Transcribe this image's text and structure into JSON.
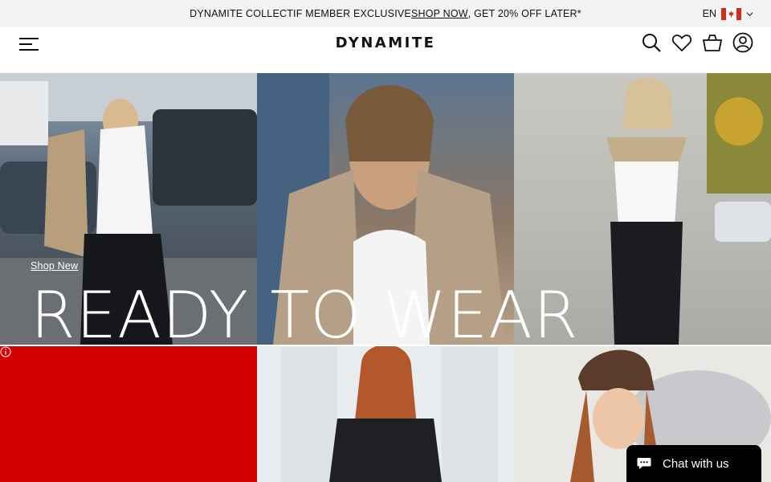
{
  "promo": {
    "text_before": "DYNAMITE COLLECTIF MEMBER EXCLUSIVE ",
    "link": "SHOP NOW",
    "text_after": ", GET 20% OFF LATER*"
  },
  "language": {
    "code": "EN",
    "flag_icon": "canada-flag-icon"
  },
  "header": {
    "logo": "DYNAMITE",
    "icons": [
      "menu-icon",
      "search-icon",
      "heart-icon",
      "bag-icon",
      "account-icon"
    ]
  },
  "hero": {
    "shop_link": "Shop New",
    "title": "READY TO WEAR"
  },
  "chat": {
    "label": "Chat with us"
  },
  "colors": {
    "promo_bg": "#f3f3f3",
    "red_tile": "#d40000",
    "chat_bg": "#000000"
  }
}
